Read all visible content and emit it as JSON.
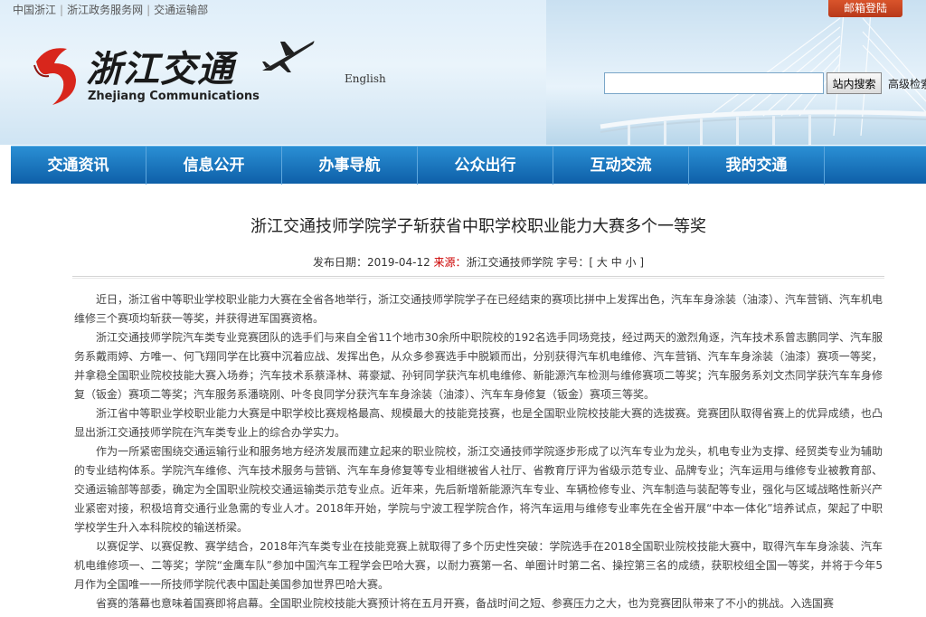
{
  "header": {
    "toplinks": [
      "中国浙江",
      "浙江政务服务网",
      "交通运输部"
    ],
    "mail_login": "邮箱登陆",
    "logo_cn": "浙江交通",
    "logo_en": "Zhejiang Communications",
    "english": "English",
    "search_placeholder": "",
    "search_button": "站内搜索",
    "advanced_search": "高级检索"
  },
  "nav": {
    "items": [
      "交通资讯",
      "信息公开",
      "办事导航",
      "公众出行",
      "互动交流",
      "我的交通"
    ]
  },
  "article": {
    "title": "浙江交通技师学院学子斩获省中职学校职业能力大赛多个一等奖",
    "date_label": "发布日期：",
    "date": "2019-04-12",
    "source_label": "来源：",
    "source": "浙江交通技师学院",
    "font_size_label": "字号：[ 大 中 小 ]",
    "paragraphs": [
      "近日，浙江省中等职业学校职业能力大赛在全省各地举行，浙江交通技师学院学子在已经结束的赛项比拼中上发挥出色，汽车车身涂装（油漆）、汽车营销、汽车机电维修三个赛项均斩获一等奖，并获得进军国赛资格。",
      "浙江交通技师学院汽车类专业竞赛团队的选手们与来自全省11个地市30余所中职院校的192名选手同场竞技，经过两天的激烈角逐，汽车技术系曾志鹏同学、汽车服务系戴雨婷、方唯一、何飞翔同学在比赛中沉着应战、发挥出色，从众多参赛选手中脱颖而出，分别获得汽车机电维修、汽车营销、汽车车身涂装（油漆）赛项一等奖，并拿稳全国职业院校技能大赛入场券；汽车技术系蔡泽林、蒋豪斌、孙钶同学获汽车机电维修、新能源汽车检测与维修赛项二等奖；汽车服务系刘文杰同学获汽车车身修复（钣金）赛项二等奖；汽车服务系潘晓刚、叶冬良同学分获汽车车身涂装（油漆）、汽车车身修复（钣金）赛项三等奖。",
      "浙江省中等职业学校职业能力大赛是中职学校比赛规格最高、规模最大的技能竞技赛，也是全国职业院校技能大赛的选拔赛。竞赛团队取得省赛上的优异成绩，也凸显出浙江交通技师学院在汽车类专业上的综合办学实力。",
      "作为一所紧密围绕交通运输行业和服务地方经济发展而建立起来的职业院校，浙江交通技师学院逐步形成了以汽车专业为龙头，机电专业为支撑、经贸类专业为辅助的专业结构体系。学院汽车维修、汽车技术服务与营销、汽车车身修复等专业相继被省人社厅、省教育厅评为省级示范专业、品牌专业；汽车运用与维修专业被教育部、交通运输部等部委，确定为全国职业院校交通运输类示范专业点。近年来，先后新增新能源汽车专业、车辆检修专业、汽车制造与装配等专业，强化与区域战略性新兴产业紧密对接，积极培育交通行业急需的专业人才。2018年开始，学院与宁波工程学院合作，将汽车运用与维修专业率先在全省开展“中本一体化”培养试点，架起了中职学校学生升入本科院校的输送桥梁。",
      "以赛促学、以赛促教、赛学结合，2018年汽车类专业在技能竞赛上就取得了多个历史性突破：学院选手在2018全国职业院校技能大赛中，取得汽车车身涂装、汽车机电维修项一、二等奖；学院“金鹰车队”参加中国汽车工程学会巴哈大赛，以耐力赛第一名、单圈计时第二名、操控第三名的成绩，获职校组全国一等奖，并将于今年5月作为全国唯一一所技师学院代表中国赴美国参加世界巴哈大赛。",
      "省赛的落幕也意味着国赛即将启幕。全国职业院校技能大赛预计将在五月开赛，备战时间之短、参赛压力之大，也为竞赛团队带来了不小的挑战。入选国赛"
    ]
  },
  "colors": {
    "nav_bg": "#1273bf",
    "mail_button": "#c8441f",
    "source_label": "#cc0000",
    "logo_red": "#d8261c"
  }
}
